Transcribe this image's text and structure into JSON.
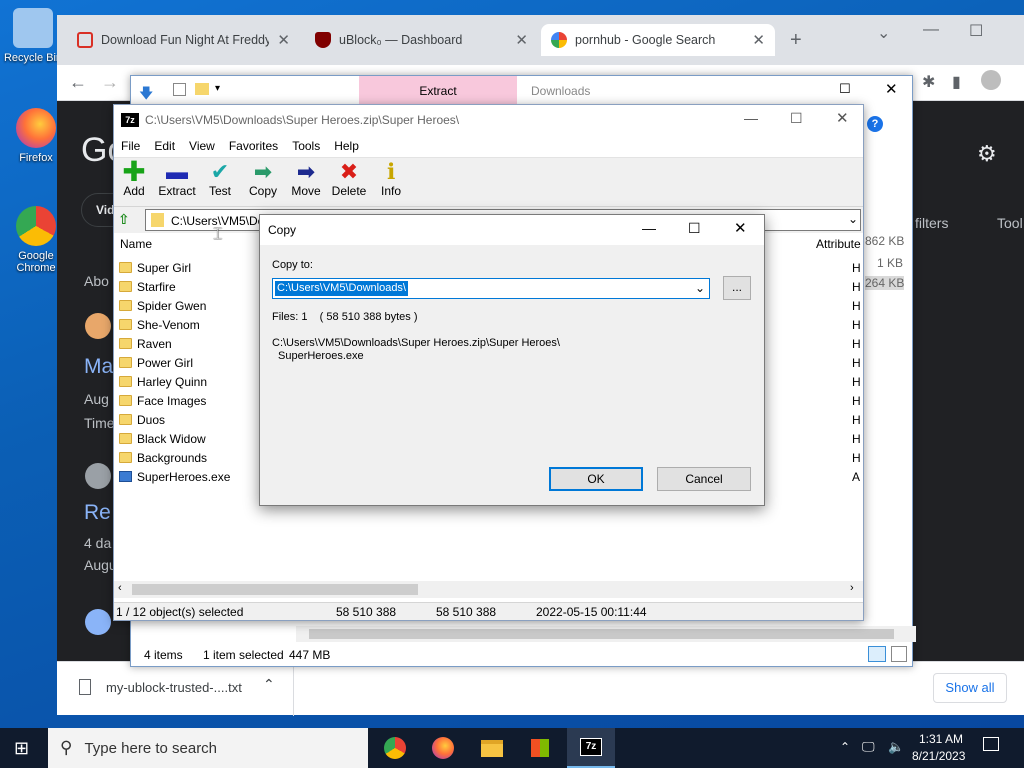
{
  "desktop": {
    "icons": [
      {
        "label": "Recycle Bin",
        "color": "#9fc7ef"
      },
      {
        "label": "Firefox",
        "color": "#ff7139"
      },
      {
        "label": "Google Chrome",
        "color": "#4285f4"
      }
    ]
  },
  "chrome": {
    "tabs": [
      {
        "label": "Download Fun Night At Freddy's",
        "color": "#d93025"
      },
      {
        "label": "uBlock₀ — Dashboard",
        "color": "#800000"
      },
      {
        "label": "pornhub - Google Search",
        "color": "#4285f4"
      }
    ],
    "new_tab": "+",
    "page": {
      "logo": "Go",
      "nav_first": "Vid",
      "filters": "filters",
      "tools": "Tool",
      "results": [
        {
          "snippet": "Abo",
          "title": "Ma",
          "date": "Aug",
          "meta": "Time"
        },
        {
          "title": "Re",
          "date": "4 da",
          "meta": "Augu"
        }
      ]
    },
    "download": {
      "file": "my-ublock-trusted-....txt",
      "show_all": "Show all"
    }
  },
  "explorer": {
    "tab_extract": "Extract",
    "tab_downloads": "Downloads",
    "sizes": [
      "862 KB",
      "1 KB",
      "264 KB"
    ],
    "status_items": "4 items",
    "status_selected": "1 item selected",
    "status_size": "447 MB"
  },
  "sevenzip": {
    "title": "C:\\Users\\VM5\\Downloads\\Super Heroes.zip\\Super Heroes\\",
    "menu": [
      "File",
      "Edit",
      "View",
      "Favorites",
      "Tools",
      "Help"
    ],
    "toolbar": [
      {
        "label": "Add",
        "icon": "+",
        "color": "#17a317"
      },
      {
        "label": "Extract",
        "icon": "—",
        "color": "#1f2bb3"
      },
      {
        "label": "Test",
        "icon": "✔",
        "color": "#1aa7a7"
      },
      {
        "label": "Copy",
        "icon": "➡",
        "color": "#2a9a6a"
      },
      {
        "label": "Move",
        "icon": "➡",
        "color": "#1d2a8f"
      },
      {
        "label": "Delete",
        "icon": "✖",
        "color": "#d91e18"
      },
      {
        "label": "Info",
        "icon": "i",
        "color": "#c8a600"
      }
    ],
    "address": "C:\\Users\\VM5\\De",
    "columns": {
      "name": "Name",
      "attributes": "Attribute"
    },
    "files": [
      {
        "name": "Super Girl",
        "type": "folder",
        "attr": "H"
      },
      {
        "name": "Starfire",
        "type": "folder",
        "attr": "H"
      },
      {
        "name": "Spider Gwen",
        "type": "folder",
        "attr": "H"
      },
      {
        "name": "She-Venom",
        "type": "folder",
        "attr": "H"
      },
      {
        "name": "Raven",
        "type": "folder",
        "attr": "H"
      },
      {
        "name": "Power Girl",
        "type": "folder",
        "attr": "H"
      },
      {
        "name": "Harley Quinn",
        "type": "folder",
        "attr": "H"
      },
      {
        "name": "Face Images",
        "type": "folder",
        "attr": "H"
      },
      {
        "name": "Duos",
        "type": "folder",
        "attr": "H"
      },
      {
        "name": "Black Widow",
        "type": "folder",
        "attr": "H"
      },
      {
        "name": "Backgrounds",
        "type": "folder",
        "attr": "H"
      },
      {
        "name": "SuperHeroes.exe",
        "type": "exe",
        "attr": "A"
      }
    ],
    "status": {
      "selection": "1 / 12 object(s) selected",
      "size": "58 510 388",
      "packed": "58 510 388",
      "modified": "2022-05-15 00:11:44"
    }
  },
  "copy_dialog": {
    "title": "Copy",
    "copy_to_label": "Copy to:",
    "path": "C:\\Users\\VM5\\Downloads\\",
    "browse": "...",
    "files_info": "Files: 1    ( 58 510 388 bytes )",
    "source_line1": "C:\\Users\\VM5\\Downloads\\Super Heroes.zip\\Super Heroes\\",
    "source_line2": "SuperHeroes.exe",
    "ok": "OK",
    "cancel": "Cancel"
  },
  "taskbar": {
    "search_placeholder": "Type here to search",
    "time": "1:31 AM",
    "date": "8/21/2023"
  }
}
